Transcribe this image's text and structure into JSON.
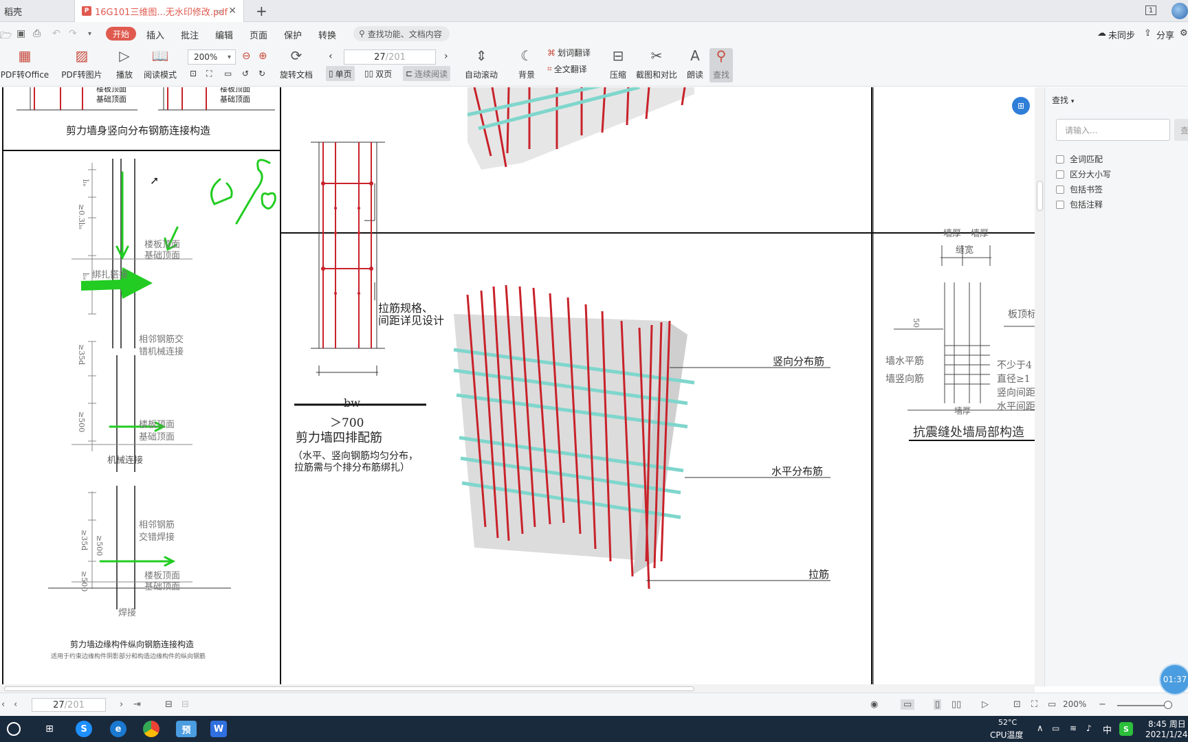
{
  "tabs": {
    "home": "稻壳",
    "doc_badge": "P",
    "doc_title": "16G101三维图...无水印修改.pdf",
    "close": "✕",
    "mini": "▭",
    "add": "+",
    "page_badge": "1"
  },
  "menu": {
    "start": "开始",
    "items": [
      "插入",
      "批注",
      "编辑",
      "页面",
      "保护",
      "转换"
    ],
    "search_placeholder": "查找功能、文档内容",
    "sync": "未同步",
    "share": "分享"
  },
  "toolbar": {
    "pdf_to_office": "PDF转Office",
    "pdf_to_image": "PDF转图片",
    "play": "播放",
    "read_mode": "阅读模式",
    "zoom": "200%",
    "rotate": "旋转文档",
    "page_current": "27",
    "page_total": "/201",
    "single": "单页",
    "double": "双页",
    "continuous": "连续阅读",
    "auto_scroll": "自动滚动",
    "background": "背景",
    "word_translate": "划词翻译",
    "full_translate": "全文翻译",
    "compress": "压缩",
    "screenshot_compare": "截图和对比",
    "read_aloud": "朗读",
    "find": "查找"
  },
  "drawing": {
    "left_top_label1": "楼板顶面",
    "left_top_label2": "基础顶面",
    "left_top_caption": "剪力墙身竖向分布钢筋连接构造",
    "tl_ln_a": "lₗₑ",
    "tl_03": "≥0.3lₗₑ",
    "tl_ln_b": "lₗₑ",
    "left_floor1": "楼板顶面",
    "left_floor2": "基础顶面",
    "left_tie": "绑扎搭接",
    "left_mech_note1": "相邻钢筋交",
    "left_mech_note2": "错机械连接",
    "left_35d": "≥35d",
    "left_500": "≥500",
    "left_floor3": "楼板顶面",
    "left_floor4": "基础顶面",
    "left_mech": "机械连接",
    "left_weld_note1": "相邻钢筋",
    "left_weld_note2": "交错焊接",
    "left_35d_b": "≥35d",
    "left_500_b": "≥500",
    "left_500_c": "≥500",
    "left_floor5": "楼板顶面",
    "left_floor6": "基础顶面",
    "left_weld": "焊接",
    "left_caption": "剪力墙边缘构件纵向钢筋连接构造",
    "left_subcaption": "适用于约束边缘构件阴影部分和构造边缘构件的纵向钢筋",
    "small_label1": "拉筋规格、",
    "small_label2": "间距详见设计",
    "bw": "bw",
    "gt700": "＞700",
    "four_row": "剪力墙四排配筋",
    "four_row_note1": "（水平、竖向钢筋均匀分布，",
    "four_row_note2": "拉筋需与个排分布筋绑扎）",
    "vert_bar": "竖向分布筋",
    "horiz_bar": "水平分布筋",
    "tie_bar": "拉筋",
    "right_wall_thk1": "墙厚",
    "right_wall_thk2": "墙厚",
    "right_gap": "缝宽",
    "right_50": "50",
    "right_slab": "板顶标",
    "right_horiz": "墙水平筋",
    "right_vert": "墙竖向筋",
    "right_note1": "不少于4",
    "right_note2": "直径≥1",
    "right_note3": "竖向间距",
    "right_note4": "水平间距",
    "right_wall_thk3": "墙厚",
    "right_caption": "抗震缝处墙局部构造"
  },
  "find_panel": {
    "title": "查找",
    "placeholder": "请输入...",
    "go": "查",
    "options": [
      "全词匹配",
      "区分大小写",
      "包括书签",
      "包括注释"
    ]
  },
  "status": {
    "page_current": "27",
    "page_total": "/201",
    "zoom": "200%"
  },
  "timer": "01:37",
  "taskbar": {
    "temp": "52°C",
    "temp_label": "CPU温度",
    "ime": "中",
    "time": "8:45 周日",
    "date": "2021/1/24",
    "app_wps_label": "预"
  },
  "colors": {
    "accent": "#e05a4f",
    "rebar_red": "#c8222a",
    "rebar_cyan": "#7fd6cc",
    "annotation_green": "#22cc22"
  }
}
